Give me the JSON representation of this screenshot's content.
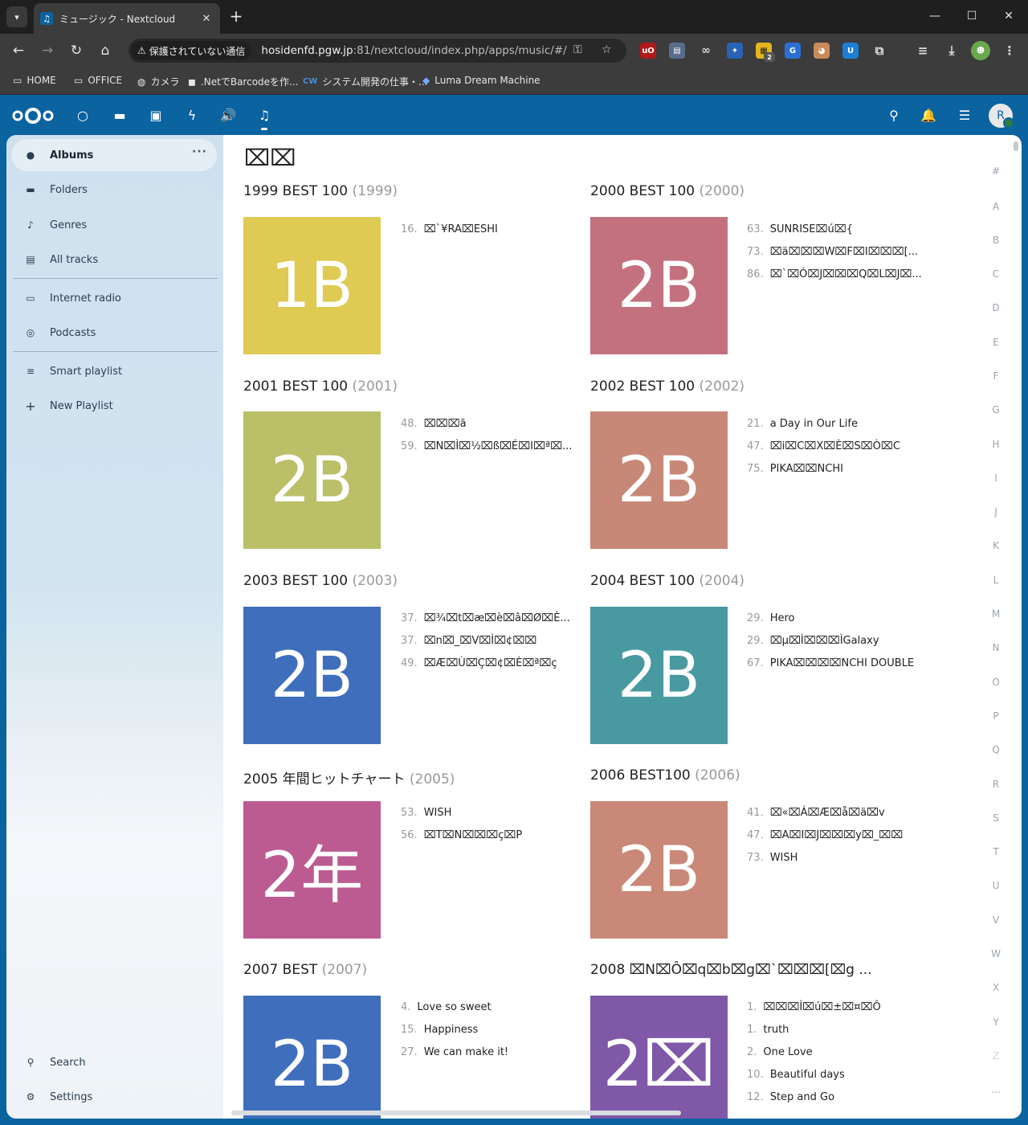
{
  "browser": {
    "tab_title": "ミュージック - Nextcloud",
    "new_tab": "+",
    "security_label": "保護されていない通信",
    "url_host": "hosidenfd.pgw.jp",
    "url_rest": ":81/nextcloud/index.php/apps/music/#/",
    "bookmarks": [
      "HOME",
      "OFFICE",
      "カメラ",
      ".NetでBarcodeを作...",
      "システム開発の仕事・...",
      "Luma Dream Machine"
    ],
    "extension_badge": "2"
  },
  "nextcloud": {
    "avatar_initial": "R"
  },
  "sidebar": {
    "items": [
      {
        "label": "Albums",
        "icon": "disc-icon"
      },
      {
        "label": "Folders",
        "icon": "folder-icon"
      },
      {
        "label": "Genres",
        "icon": "music-note-icon"
      },
      {
        "label": "All tracks",
        "icon": "library-icon"
      },
      {
        "label": "Internet radio",
        "icon": "radio-icon"
      },
      {
        "label": "Podcasts",
        "icon": "podcast-icon"
      },
      {
        "label": "Smart playlist",
        "icon": "smart-playlist-icon"
      },
      {
        "label": "New Playlist",
        "icon": "plus-icon"
      }
    ],
    "more": "…",
    "search": "Search",
    "settings": "Settings"
  },
  "main": {
    "page_title": "⌧⌧",
    "albums": [
      {
        "title": "1999 BEST 100",
        "year": "(1999)",
        "cover_text": "1B",
        "color": "#dfca53",
        "tracks": [
          {
            "num": "16.",
            "title": "⌧`¥RA⌧ESHI"
          }
        ]
      },
      {
        "title": "2000 BEST 100",
        "year": "(2000)",
        "cover_text": "2B",
        "color": "#c3707f",
        "tracks": [
          {
            "num": "63.",
            "title": "SUNRISE⌧ú⌧{"
          },
          {
            "num": "73.",
            "title": "⌧ä⌧⌧⌧W⌧F⌧I⌧⌧⌧[..."
          },
          {
            "num": "86.",
            "title": "⌧`⌧Ó⌧J⌧⌧⌧Q⌧L⌧J⌧..."
          }
        ]
      },
      {
        "title": "2001 BEST 100",
        "year": "(2001)",
        "cover_text": "2B",
        "color": "#bbbf68",
        "tracks": [
          {
            "num": "48.",
            "title": "⌧⌧⌧ã"
          },
          {
            "num": "59.",
            "title": "⌧N⌧Ì⌧½⌧ß⌧É⌧I⌧ª⌧..."
          }
        ]
      },
      {
        "title": "2002 BEST 100",
        "year": "(2002)",
        "cover_text": "2B",
        "color": "#c88878",
        "tracks": [
          {
            "num": "21.",
            "title": "a Day in Our Life"
          },
          {
            "num": "47.",
            "title": "⌧i⌧C⌧X⌧È⌧S⌧Ò⌧C"
          },
          {
            "num": "75.",
            "title": "PIKA⌧⌧NCHI"
          }
        ]
      },
      {
        "title": "2003 BEST 100",
        "year": "(2003)",
        "cover_text": "2B",
        "color": "#3f6ebc",
        "tracks": [
          {
            "num": "37.",
            "title": "⌧¾⌧t⌧æ⌧è⌧â⌧Ø⌧È..."
          },
          {
            "num": "37.",
            "title": "⌧n⌧_⌧V⌧Ì⌧¢⌧⌧"
          },
          {
            "num": "49.",
            "title": "⌧Æ⌧Ù⌧Ç⌧¢⌧È⌧ª⌧ç"
          }
        ]
      },
      {
        "title": "2004 BEST 100",
        "year": "(2004)",
        "cover_text": "2B",
        "color": "#4999a1",
        "tracks": [
          {
            "num": "29.",
            "title": "Hero"
          },
          {
            "num": "29.",
            "title": "⌧µ⌧Ì⌧⌧⌧ÌGalaxy"
          },
          {
            "num": "67.",
            "title": "PIKA⌧⌧⌧⌧NCHI DOUBLE"
          }
        ]
      },
      {
        "title": "2005 年間ヒットチャート",
        "year": "(2005)",
        "cover_text": "2年",
        "color": "#bc5b91",
        "tracks": [
          {
            "num": "53.",
            "title": "WISH"
          },
          {
            "num": "56.",
            "title": "⌧T⌧N⌧⌧⌧ç⌧P"
          }
        ]
      },
      {
        "title": "2006 BEST100",
        "year": "(2006)",
        "cover_text": "2B",
        "color": "#c98878",
        "tracks": [
          {
            "num": "41.",
            "title": "⌧«⌧Á⌧Æ⌧å⌧ä⌧v"
          },
          {
            "num": "47.",
            "title": "⌧A⌧I⌧J⌧⌧⌧y⌧_⌧⌧"
          },
          {
            "num": "73.",
            "title": "WISH"
          }
        ]
      },
      {
        "title": "2007 BEST",
        "year": "(2007)",
        "cover_text": "2B",
        "color": "#3f6ebc",
        "tracks": [
          {
            "num": "4.",
            "title": "Love so sweet"
          },
          {
            "num": "15.",
            "title": "Happiness"
          },
          {
            "num": "27.",
            "title": "We can make it!"
          }
        ]
      },
      {
        "title": "2008 ⌧N⌧Ô⌧q⌧b⌧g⌧`⌧⌧⌧[⌧g ...",
        "year": "",
        "cover_text": "2⌧",
        "color": "#7f58a8",
        "tracks": [
          {
            "num": "1.",
            "title": "⌧⌧⌧Ì⌧ú⌧±⌧¤⌧Ô"
          },
          {
            "num": "1.",
            "title": "truth"
          },
          {
            "num": "2.",
            "title": "One Love"
          },
          {
            "num": "10.",
            "title": "Beautiful days"
          },
          {
            "num": "12.",
            "title": "Step and Go"
          }
        ]
      }
    ],
    "alphabet": [
      "#",
      "A",
      "B",
      "C",
      "D",
      "E",
      "F",
      "G",
      "H",
      "I",
      "J",
      "K",
      "L",
      "M",
      "N",
      "O",
      "P",
      "Q",
      "R",
      "S",
      "T",
      "U",
      "V",
      "W",
      "X",
      "Y",
      "Z",
      "..."
    ]
  }
}
